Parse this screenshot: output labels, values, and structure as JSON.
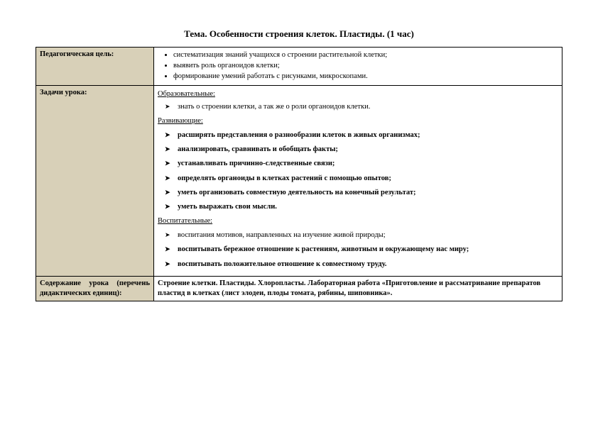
{
  "title": "Тема. Особенности строения клеток. Пластиды. (1 час)",
  "rows": {
    "goal": {
      "label": "Педагогическая цель:",
      "bullets": [
        "систематизация знаний учащихся о строении растительной клетки;",
        "выявить роль органоидов клетки;",
        " формирование умений работать с рисунками, микроскопами."
      ]
    },
    "tasks": {
      "label": "Задачи урока:",
      "edu_head": "Образовательные:",
      "edu_items": [
        "знать о строении  клетки, а так же о роли органоидов клетки."
      ],
      "dev_head": "Развивающие:",
      "dev_items": [
        "расширять  представления о разнообразии клеток в живых организмах;",
        "анализировать, сравнивать и обобщать факты;",
        "устанавливать причинно-следственные связи;",
        "определять органоиды  в клетках растений с помощью опытов;",
        "уметь организовать совместную деятельность на конечный результат;",
        "уметь выражать свои мысли."
      ],
      "vos_head": " Воспитательные:",
      "vos_items": [
        "воспитания мотивов, направленных на изучение живой природы;",
        "воспитывать бережное отношение к растениям, животным и окружающему нас миру;",
        "воспитывать положительное отношение к совместному труду."
      ]
    },
    "content": {
      "label": "Содержание урока (перечень дидактических единиц):",
      "text": "Строение клетки. Пластиды. Хлоропласты. Лабораторная работа «Приготовление и рассматривание препаратов пластид в клетках (лист элодеи, плоды томата, рябины, шиповника»."
    }
  }
}
